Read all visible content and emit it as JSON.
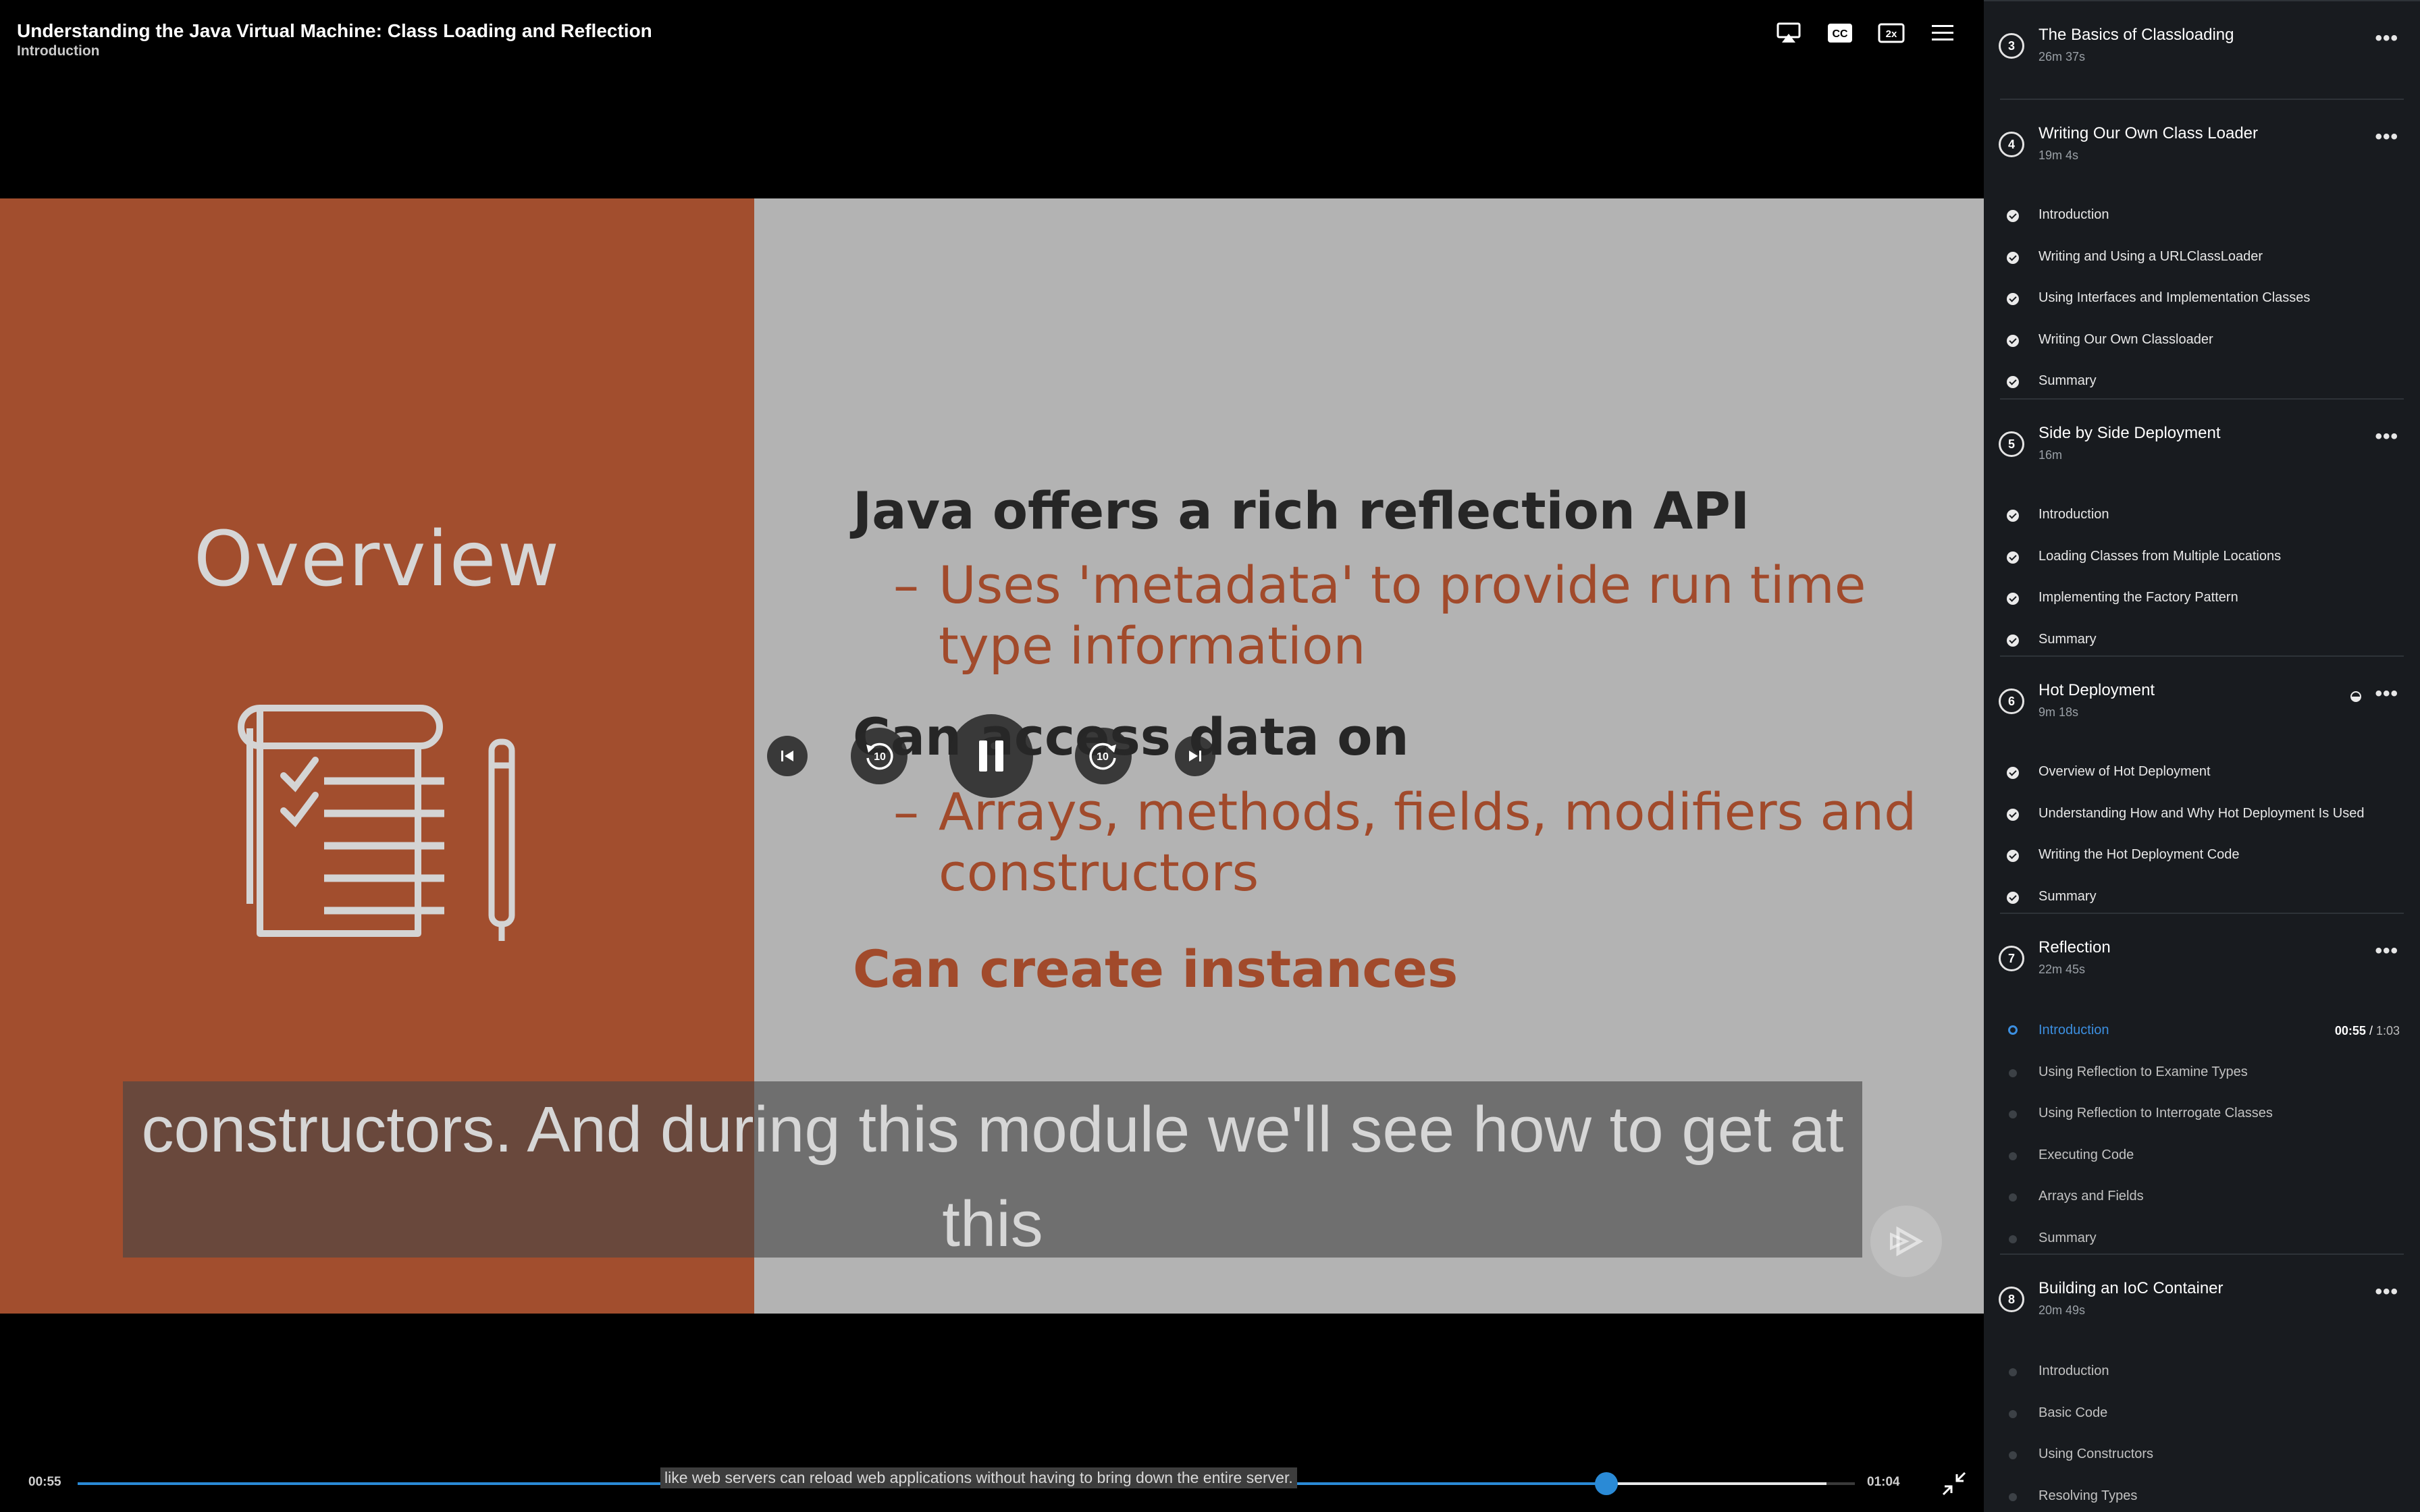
{
  "player": {
    "title": "Understanding the Java Virtual Machine: Class Loading and Reflection",
    "subtitle": "Introduction",
    "icons": [
      "airplay-icon",
      "closed-captions-icon",
      "playback-speed-icon",
      "menu-icon"
    ],
    "cc_label": "CC",
    "speed_label": "2x"
  },
  "slide": {
    "left_heading": "Overview",
    "items": [
      {
        "heading": "Java offers a rich reflection API",
        "bullets": [
          "Uses 'metadata' to provide run time",
          "type information"
        ]
      },
      {
        "heading": "Can access data on",
        "bullets": [
          "Arrays, methods, fields, modifiers and",
          "constructors"
        ]
      },
      {
        "heading": "Can create instances",
        "bullets": []
      }
    ],
    "bullet_dash": "–"
  },
  "caption": {
    "line1": "constructors. And during this module we'll see how to get at",
    "line2": "this"
  },
  "controls": {
    "skip_back_seconds": "10",
    "skip_forward_seconds": "10",
    "current_time": "00:55",
    "total_time": "01:04",
    "progress_fraction": 0.86,
    "buffer_fraction": 0.984,
    "seek_tooltip": "like web servers can reload web applications without having to bring down the entire server."
  },
  "sidebar": {
    "more_label": "•••",
    "sections": [
      {
        "number": "3",
        "title": "The Basics of Classloading",
        "duration": "26m 37s",
        "clips": []
      },
      {
        "number": "4",
        "title": "Writing Our Own Class Loader",
        "duration": "19m 4s",
        "clips": [
          {
            "label": "Introduction",
            "status": "done"
          },
          {
            "label": "Writing and Using a URLClassLoader",
            "status": "done"
          },
          {
            "label": "Using Interfaces and Implementation Classes",
            "status": "done"
          },
          {
            "label": "Writing Our Own Classloader",
            "status": "done"
          },
          {
            "label": "Summary",
            "status": "done"
          }
        ]
      },
      {
        "number": "5",
        "title": "Side by Side Deployment",
        "duration": "16m",
        "clips": [
          {
            "label": "Introduction",
            "status": "done"
          },
          {
            "label": "Loading Classes from Multiple Locations",
            "status": "done"
          },
          {
            "label": "Implementing the Factory Pattern",
            "status": "done"
          },
          {
            "label": "Summary",
            "status": "done"
          }
        ]
      },
      {
        "number": "6",
        "title": "Hot Deployment",
        "duration": "9m 18s",
        "clips": [
          {
            "label": "Overview of Hot Deployment",
            "status": "done"
          },
          {
            "label": "Understanding How and Why Hot Deployment Is Used",
            "status": "done"
          },
          {
            "label": "Writing the Hot Deployment Code",
            "status": "done"
          },
          {
            "label": "Summary",
            "status": "done"
          }
        ]
      },
      {
        "number": "7",
        "title": "Reflection",
        "duration": "22m 45s",
        "clips": [
          {
            "label": "Introduction",
            "status": "current",
            "time_current": "00:55",
            "time_total": "1:03"
          },
          {
            "label": "Using Reflection to Examine Types",
            "status": "todo"
          },
          {
            "label": "Using Reflection to Interrogate Classes",
            "status": "todo"
          },
          {
            "label": "Executing Code",
            "status": "todo"
          },
          {
            "label": "Arrays and Fields",
            "status": "todo"
          },
          {
            "label": "Summary",
            "status": "todo"
          }
        ]
      },
      {
        "number": "8",
        "title": "Building an IoC Container",
        "duration": "20m 49s",
        "clips": [
          {
            "label": "Introduction",
            "status": "todo"
          },
          {
            "label": "Basic Code",
            "status": "todo"
          },
          {
            "label": "Using Constructors",
            "status": "todo"
          },
          {
            "label": "Resolving Types",
            "status": "todo"
          }
        ]
      }
    ]
  },
  "colors": {
    "accent": "#2a8ad6",
    "slide_orange": "#a24e2e",
    "sidebar_bg": "#181b1f"
  }
}
